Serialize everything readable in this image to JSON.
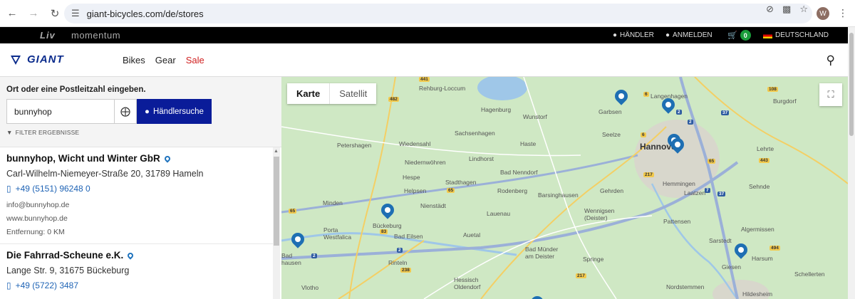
{
  "browser": {
    "url": "giant-bicycles.com/de/stores",
    "profile_initial": "W"
  },
  "topbar": {
    "brands": [
      "Liv",
      "momentum"
    ],
    "dealer_label": "HÄNDLER",
    "login_label": "ANMELDEN",
    "cart_count": "0",
    "country_label": "DEUTSCHLAND"
  },
  "header": {
    "logo_text": "GIANT",
    "nav": [
      "Bikes",
      "Gear",
      "Sale"
    ]
  },
  "search": {
    "prompt": "Ort oder eine Postleitzahl eingeben.",
    "input_value": "bunnyhop",
    "button_label": "Händlersuche",
    "filter_label": "FILTER ERGEBNISSE"
  },
  "results": [
    {
      "name": "bunnyhop, Wicht und Winter GbR",
      "address": "Carl-Wilhelm-Niemeyer-Straße 20, 31789 Hameln",
      "phone": "+49 (5151) 96248 0",
      "email": "info@bunnyhop.de",
      "website": "www.bunnyhop.de",
      "distance": "Entfernung: 0 KM"
    },
    {
      "name": "Die Fahrrad-Scheune e.K.",
      "address": "Lange Str. 9, 31675 Bückeburg",
      "phone": "+49 (5722) 3487"
    }
  ],
  "map": {
    "type_buttons": [
      "Karte",
      "Satellit"
    ],
    "places": {
      "hannover": "Hannover",
      "rehburg": "Rehburg-Loccum",
      "hagenburg": "Hagenburg",
      "wunstorf": "Wunstorf",
      "garbsen": "Garbsen",
      "langenhagen": "Langenhagen",
      "burgdorf": "Burgdorf",
      "sachsenhagen": "Sachsenhagen",
      "seelze": "Seelze",
      "petershagen": "Petershagen",
      "wiedensahl": "Wiedensahl",
      "haste": "Haste",
      "lehrte": "Lehrte",
      "lindhorst": "Lindhorst",
      "niedernwohren": "Niedernwöhren",
      "hespe": "Hespe",
      "badnenndorf": "Bad Nenndorf",
      "stadthagen": "Stadthagen",
      "helpsen": "Helpsen",
      "rodenberg": "Rodenberg",
      "barsinghausen": "Barsinghausen",
      "gehrden": "Gehrden",
      "hemmingen": "Hemmingen",
      "laatzen": "Laatzen",
      "sehnde": "Sehnde",
      "minden": "Minden",
      "nienstadt": "Nienstädt",
      "lauenau": "Lauenau",
      "wennigsen": "Wennigsen\n(Deister)",
      "pattensen": "Pattensen",
      "porta": "Porta\nWestfalica",
      "buckeburg": "Bückeburg",
      "badeilsen": "Bad Eilsen",
      "auetal": "Auetal",
      "algermissen": "Algermissen",
      "sarstedt": "Sarstedt",
      "badmunder": "Bad Münder\nam Deister",
      "springe": "Springe",
      "harsum": "Harsum",
      "giesen": "Giesen",
      "schellerten": "Schellerten",
      "rinteln": "Rinteln",
      "badhausen": "Bad\nhausen",
      "vlotho": "Vlotho",
      "hessisch": "Hessisch\nOldendorf",
      "nordstemmen": "Nordstemmen",
      "hildesheim": "Hildesheim"
    },
    "roads": {
      "r441": "441",
      "r482": "482",
      "r6a": "6",
      "r2a": "2",
      "r37a": "37",
      "r108": "108",
      "r6b": "6",
      "r2b": "2",
      "r65a": "65",
      "r443": "443",
      "r217": "217",
      "r7": "7",
      "r37b": "37",
      "r65b": "65",
      "r65c": "65",
      "r83": "83",
      "r2c": "2",
      "r2d": "2",
      "r238": "238",
      "r217b": "217",
      "r494": "494"
    }
  }
}
